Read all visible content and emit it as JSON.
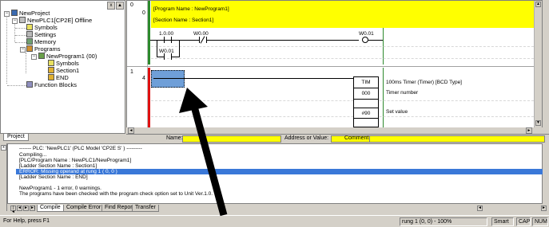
{
  "tree": {
    "project": "NewProject",
    "plc": "NewPLC1[CP2E] Offline",
    "symbols": "Symbols",
    "settings": "Settings",
    "memory": "Memory",
    "programs": "Programs",
    "program": "NewProgram1 (00)",
    "prog_symbols": "Symbols",
    "section1": "Section1",
    "end": "END",
    "function_blocks": "Function Blocks"
  },
  "project_tab": "Project",
  "ladder": {
    "rung0_num": "0",
    "rung0_step": "0",
    "program_name": "[Program Name : NewProgram1]",
    "section_name": "[Section Name : Section1]",
    "contact1": "1.0.00",
    "contact2": "W0.00",
    "contact3": "W0.01",
    "coil1": "W0.01",
    "rung1_num": "1",
    "rung1_step": "4",
    "timer_mnemonic": "TIM",
    "timer_number": "000",
    "timer_set": "#90",
    "timer_desc": "100ms Timer (Timer) [BCD Type]",
    "timer_num_desc": "Timer number",
    "timer_set_desc": "Set value"
  },
  "namebar": {
    "name_label": "Name:",
    "address_label": "Address or Value:",
    "comment_label": "Comment:"
  },
  "output": {
    "lines": [
      "------- PLC: 'NewPLC1' (PLC Model 'CP2E S' ) ---------",
      "Compiling...",
      "[PLC/Program Name : NewPLC1/NewProgram1]",
      "[Ladder Section Name : Section1]",
      "ERROR: Missing operand at rung 1 ( 0, 0 )",
      "[Ladder Section Name : END]",
      "",
      "NewProgram1 - 1 error, 0 warnings.",
      "The programs have been checked with the program check option set to Unit Ver.1.0."
    ],
    "tabs": [
      "Compile",
      "Compile Error",
      "Find Report",
      "Transfer"
    ]
  },
  "status": {
    "help": "For Help, press F1",
    "position": "rung 1 (0, 0) - 100%",
    "mode": "Smart",
    "cap": "CAP",
    "num": "NUM"
  },
  "colors": {
    "yellow": "#ffff00",
    "rail_green": "#2d8a2d",
    "rail_red": "#e01010",
    "selection": "#6f9fd8",
    "error_highlight": "#3a78d8"
  }
}
